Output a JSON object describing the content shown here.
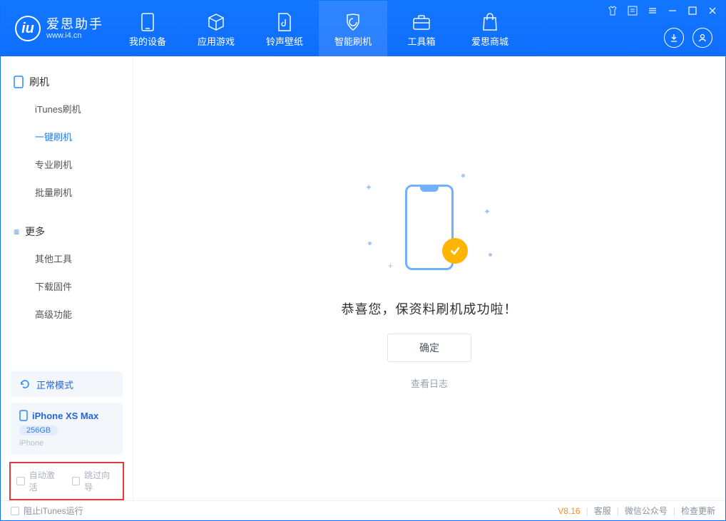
{
  "app": {
    "name": "爱思助手",
    "url": "www.i4.cn"
  },
  "nav": {
    "items": [
      {
        "label": "我的设备"
      },
      {
        "label": "应用游戏"
      },
      {
        "label": "铃声壁纸"
      },
      {
        "label": "智能刷机"
      },
      {
        "label": "工具箱"
      },
      {
        "label": "爱思商城"
      }
    ]
  },
  "sidebar": {
    "section1": {
      "title": "刷机",
      "items": [
        {
          "label": "iTunes刷机"
        },
        {
          "label": "一键刷机"
        },
        {
          "label": "专业刷机"
        },
        {
          "label": "批量刷机"
        }
      ]
    },
    "section2": {
      "title": "更多",
      "items": [
        {
          "label": "其他工具"
        },
        {
          "label": "下载固件"
        },
        {
          "label": "高级功能"
        }
      ]
    },
    "mode": "正常模式",
    "device": {
      "name": "iPhone XS Max",
      "storage": "256GB",
      "type": "iPhone"
    },
    "options": {
      "auto_activate": "自动激活",
      "skip_guide": "跳过向导"
    }
  },
  "main": {
    "success_message": "恭喜您，保资料刷机成功啦！",
    "confirm_label": "确定",
    "view_log": "查看日志"
  },
  "statusbar": {
    "block_itunes": "阻止iTunes运行",
    "version": "V8.16",
    "links": [
      "客服",
      "微信公众号",
      "检查更新"
    ]
  }
}
